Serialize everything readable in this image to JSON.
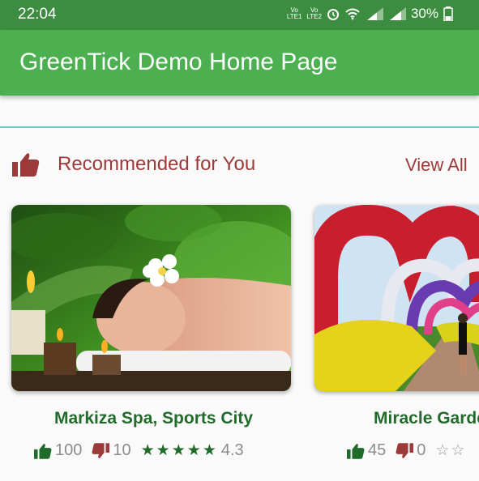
{
  "status_bar": {
    "time": "22:04",
    "network_label_1": "Vo\nLTE1",
    "network_label_2": "Vo\nLTE2",
    "battery": "30%"
  },
  "app_bar": {
    "title": "GreenTick Demo Home Page"
  },
  "section": {
    "title": "Recommended for You",
    "view_all": "View All"
  },
  "cards": [
    {
      "name": "Markiza Spa, Sports City",
      "likes": "100",
      "dislikes": "10",
      "rating": "4.3",
      "stars": 5
    },
    {
      "name": "Miracle Garden",
      "likes": "45",
      "dislikes": "0",
      "rating": "",
      "stars": 0
    }
  ],
  "colors": {
    "status_bar": "#3c8d40",
    "app_bar": "#4caf50",
    "accent_text": "#9c3a3a",
    "card_title": "#226b2c",
    "divider": "#6fcac5"
  }
}
